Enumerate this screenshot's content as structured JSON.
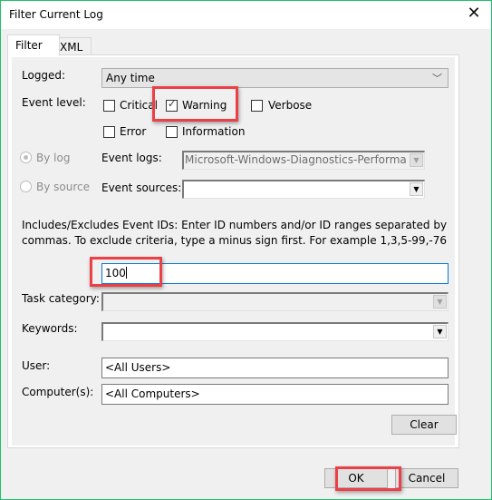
{
  "window": {
    "title": "Filter Current Log",
    "close_icon": "close-x-icon"
  },
  "tabs": [
    {
      "label": "Filter",
      "active": true
    },
    {
      "label": "XML",
      "active": false
    }
  ],
  "filter": {
    "logged": {
      "label": "Logged:",
      "value": "Any time"
    },
    "event_level": {
      "label": "Event level:",
      "options": [
        {
          "label": "Critical",
          "checked": false
        },
        {
          "label": "Warning",
          "checked": true
        },
        {
          "label": "Verbose",
          "checked": false
        },
        {
          "label": "Error",
          "checked": false
        },
        {
          "label": "Information",
          "checked": false
        }
      ]
    },
    "by_log": {
      "label": "By log",
      "selected": true
    },
    "by_source": {
      "label": "By source",
      "selected": false
    },
    "event_logs": {
      "label": "Event logs:",
      "value": "Microsoft-Windows-Diagnostics-Performance/"
    },
    "event_sources": {
      "label": "Event sources:",
      "value": ""
    },
    "event_ids": {
      "description": "Includes/Excludes Event IDs: Enter ID numbers and/or ID ranges separated by commas. To exclude criteria, type a minus sign first. For example 1,3,5-99,-76",
      "value": "100"
    },
    "task_category": {
      "label": "Task category:",
      "value": ""
    },
    "keywords": {
      "label": "Keywords:",
      "value": ""
    },
    "user": {
      "label": "User:",
      "value": "<All Users>"
    },
    "computers": {
      "label": "Computer(s):",
      "value": "<All Computers>"
    },
    "clear_label": "Clear"
  },
  "footer": {
    "ok_label": "OK",
    "cancel_label": "Cancel"
  },
  "colors": {
    "highlight": "#ea4046",
    "window_border": "#1fc16b",
    "focus_border": "#0078d7"
  }
}
